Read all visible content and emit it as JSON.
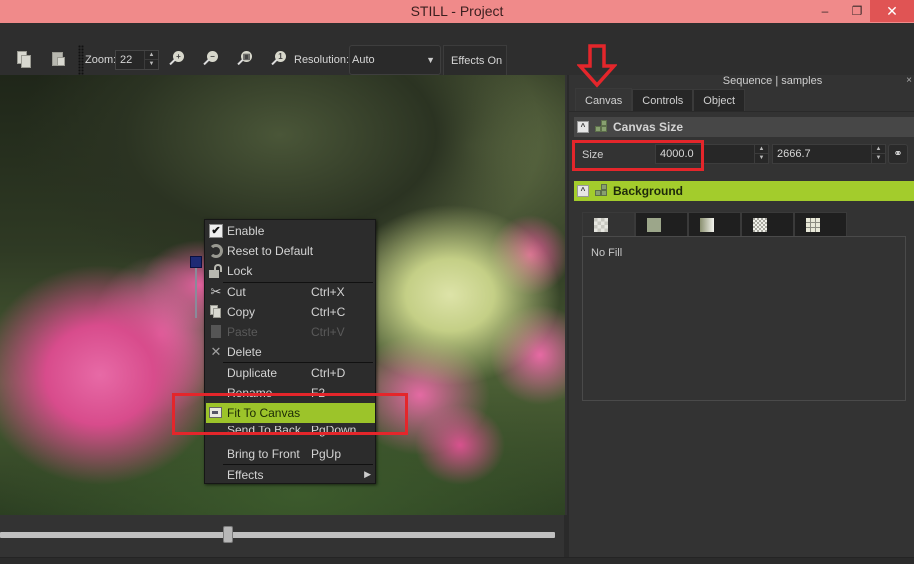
{
  "window": {
    "title": "STILL - Project",
    "minimize_glyph": "–",
    "maximize_glyph": "❐",
    "close_glyph": "✕"
  },
  "toolbar": {
    "zoom_label": "Zoom:",
    "zoom_value": "22",
    "resolution_label": "Resolution:",
    "resolution_value": "Auto",
    "effects_label": "Effects On",
    "zoom_in_glyph": "+",
    "zoom_out_glyph": "−",
    "zoom_fit_glyph": "▣",
    "zoom_actual_glyph": "1"
  },
  "viewer": {
    "slider_position": 0.41
  },
  "context_menu": {
    "items": [
      {
        "label": "Enable",
        "shortcut": "",
        "icon": "checkbox-checked-icon",
        "state": "normal"
      },
      {
        "label": "Reset to Default",
        "shortcut": "",
        "icon": "reset-icon",
        "state": "normal"
      },
      {
        "label": "Lock",
        "shortcut": "",
        "icon": "unlock-icon",
        "state": "normal"
      },
      {
        "label": "Cut",
        "shortcut": "Ctrl+X",
        "icon": "scissors-icon",
        "state": "normal"
      },
      {
        "label": "Copy",
        "shortcut": "Ctrl+C",
        "icon": "copy-icon",
        "state": "normal"
      },
      {
        "label": "Paste",
        "shortcut": "Ctrl+V",
        "icon": "paste-icon",
        "state": "disabled"
      },
      {
        "label": "Delete",
        "shortcut": "",
        "icon": "delete-icon",
        "state": "normal"
      },
      {
        "label": "Duplicate",
        "shortcut": "Ctrl+D",
        "icon": "",
        "state": "normal"
      },
      {
        "label": "Rename",
        "shortcut": "F2",
        "icon": "",
        "state": "normal"
      },
      {
        "label": "Fit To Canvas",
        "shortcut": "",
        "icon": "fit-canvas-icon",
        "state": "highlighted"
      },
      {
        "label": "Send To Back",
        "shortcut": "PgDown",
        "icon": "",
        "state": "normal"
      },
      {
        "label": "Bring to Front",
        "shortcut": "PgUp",
        "icon": "",
        "state": "normal"
      },
      {
        "label": "Effects",
        "shortcut": "",
        "icon": "",
        "state": "submenu"
      }
    ],
    "check_glyph": "✔",
    "submenu_glyph": "▶"
  },
  "panel": {
    "title": "Sequence | samples",
    "close_glyph": "×",
    "tabs": [
      {
        "label": "Canvas",
        "active": true
      },
      {
        "label": "Controls",
        "active": false
      },
      {
        "label": "Object",
        "active": false
      }
    ],
    "canvas_size": {
      "header": "Canvas Size",
      "collapse_glyph": "^",
      "size_label": "Size",
      "width": "4000.0",
      "height": "2666.7",
      "link_glyph": "⚭"
    },
    "background": {
      "header": "Background",
      "collapse_glyph": "^",
      "fill_tabs": [
        {
          "name": "no-fill",
          "active": true
        },
        {
          "name": "solid-color",
          "active": false
        },
        {
          "name": "gradient",
          "active": false
        },
        {
          "name": "transparent-pattern",
          "active": false
        },
        {
          "name": "image-tile",
          "active": false
        }
      ],
      "fill_text": "No Fill"
    }
  },
  "colors": {
    "title_bar": "#f08a8a",
    "accent_green": "#a3cc2c",
    "annotation_red": "#e4262b",
    "panel_bg": "#333333"
  }
}
